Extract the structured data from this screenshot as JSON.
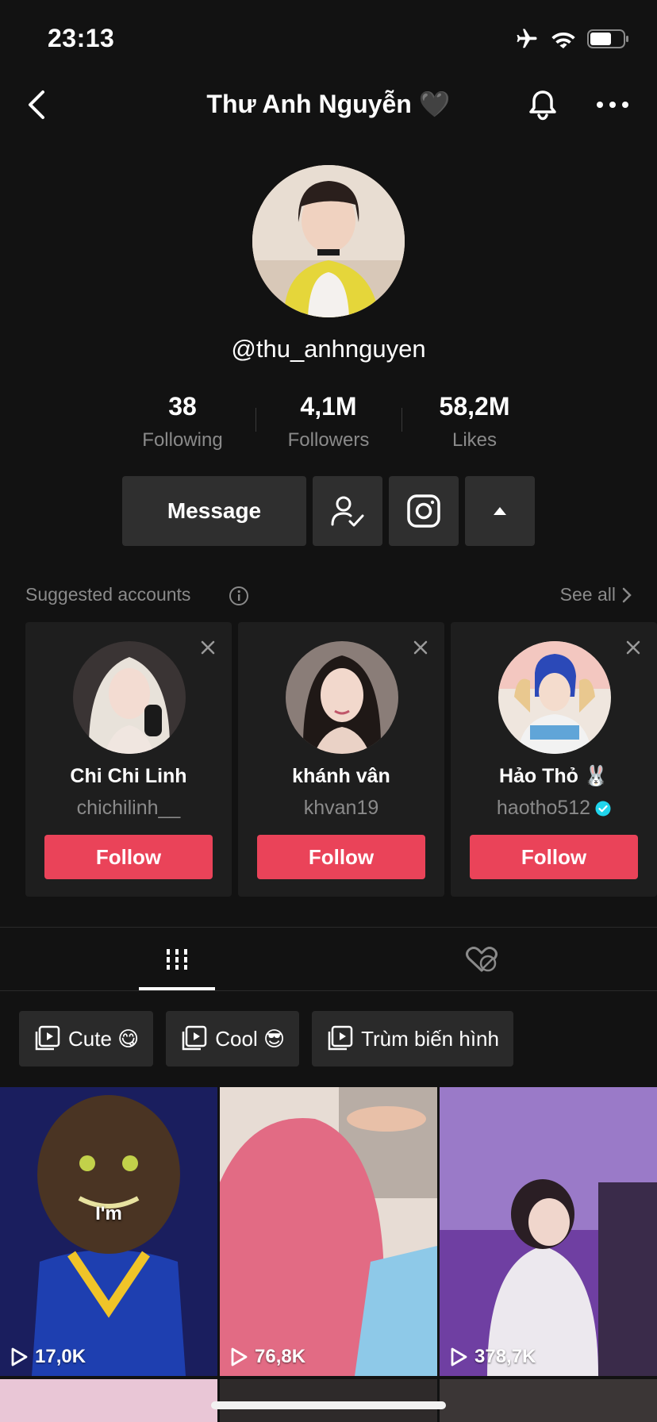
{
  "status": {
    "time": "23:13"
  },
  "header": {
    "title": "Thư Anh Nguyễn 🖤"
  },
  "profile": {
    "username": "@thu_anhnguyen",
    "stats": [
      {
        "value": "38",
        "label": "Following"
      },
      {
        "value": "4,1M",
        "label": "Followers"
      },
      {
        "value": "58,2M",
        "label": "Likes"
      }
    ],
    "message_label": "Message"
  },
  "suggested": {
    "label": "Suggested accounts",
    "see_all": "See all",
    "accounts": [
      {
        "name": "Chi Chi Linh",
        "handle": "chichilinh__",
        "follow": "Follow",
        "verified": false
      },
      {
        "name": "khánh vân",
        "handle": "khvan19",
        "follow": "Follow",
        "verified": false
      },
      {
        "name": "Hảo Thỏ 🐰",
        "handle": "haotho512",
        "follow": "Follow",
        "verified": true
      }
    ]
  },
  "playlists": [
    {
      "label": "Cute 😋"
    },
    {
      "label": "Cool 😎"
    },
    {
      "label": "Trùm biến hình"
    }
  ],
  "videos": [
    {
      "views": "17,0K",
      "caption": "I'm"
    },
    {
      "views": "76,8K"
    },
    {
      "views": "378,7K"
    }
  ],
  "colors": {
    "accent": "#ea4359",
    "background": "#121212",
    "verified": "#20d5ec"
  }
}
